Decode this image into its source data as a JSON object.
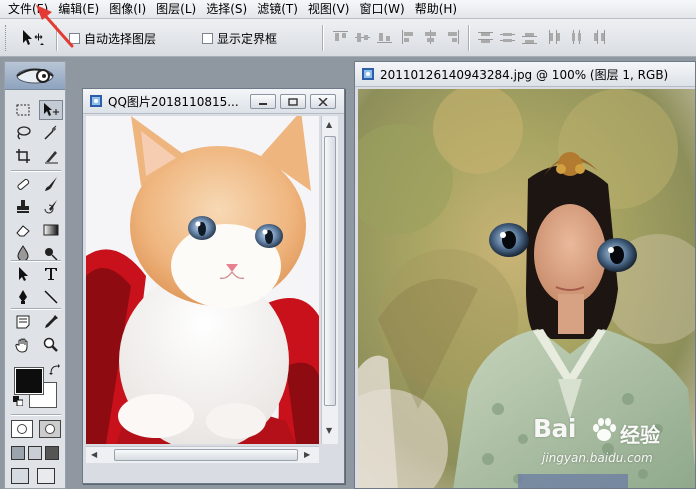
{
  "menubar": {
    "items": [
      "文件(F)",
      "编辑(E)",
      "图像(I)",
      "图层(L)",
      "选择(S)",
      "滤镜(T)",
      "视图(V)",
      "窗口(W)",
      "帮助(H)"
    ]
  },
  "options": {
    "auto_select_label": "自动选择图层",
    "show_bounds_label": "显示定界框"
  },
  "doc_left": {
    "title": "QQ图片2018110815..."
  },
  "doc_right": {
    "title": "20110126140943284.jpg @ 100% (图层 1, RGB)"
  },
  "toolbox": {
    "foreground_color": "#0d0d0d",
    "background_color": "#ffffff"
  },
  "watermark": {
    "brand": "Bai",
    "brand_tail": "经验",
    "url": "jingyan.baidu.com"
  },
  "colors": {
    "annotation_arrow": "#e33b34",
    "workspace": "#8f97a0"
  }
}
